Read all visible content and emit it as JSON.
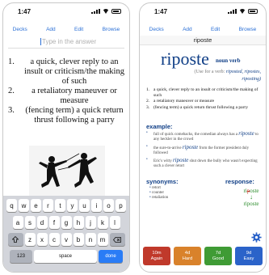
{
  "left": {
    "time": "1:47",
    "nav": [
      "Decks",
      "Add",
      "Edit",
      "Browse"
    ],
    "answer_placeholder": "Type in the answer",
    "definitions": [
      {
        "num": "1.",
        "text": "a quick, clever reply to an insult or criticism/the making of such"
      },
      {
        "num": "2.",
        "text": "a retaliatory maneuver or measure"
      },
      {
        "num": "3.",
        "text": "(fencing term) a quick return thrust following a parry"
      }
    ],
    "keyboard": {
      "row1": [
        "q",
        "w",
        "e",
        "r",
        "t",
        "y",
        "u",
        "i",
        "o",
        "p"
      ],
      "row2": [
        "a",
        "s",
        "d",
        "f",
        "g",
        "h",
        "j",
        "k",
        "l"
      ],
      "row3": [
        "z",
        "x",
        "c",
        "v",
        "b",
        "n",
        "m"
      ],
      "num_label": "123",
      "space_label": "space",
      "done_label": "done",
      "shift_icon": "shift-icon",
      "delete_icon": "delete-icon"
    }
  },
  "right": {
    "time": "1:47",
    "nav": [
      "Decks",
      "Add",
      "Edit",
      "Browse"
    ],
    "title": "riposte",
    "headword": "riposte",
    "part_of_speech": "noun verb",
    "forms_prefix": "(Use for a verb:",
    "forms_list": "riposted, ripostes,",
    "forms_last": "riposting)",
    "definitions": [
      {
        "num": "1.",
        "text": "a quick, clever reply to an insult or criticism/the making of such"
      },
      {
        "num": "2.",
        "text": "a retaliatory maneuver or measure"
      },
      {
        "num": "3.",
        "text": "(fencing term) a quick return thrust following a parry"
      }
    ],
    "example_label": "example:",
    "examples": [
      {
        "pre": "full of quick comebacks, the comedian always has a",
        "word": "riposte",
        "post": "to any heckler in the crowd"
      },
      {
        "pre": "the sure-to-arrive",
        "word": "riposte",
        "post": "from the former president duly followed"
      },
      {
        "pre": "Eric's witty",
        "word": "riposte",
        "post": "shut down the bully who wasn't expecting such a clever retort"
      }
    ],
    "synonyms_label": "synonyms:",
    "synonyms": [
      "retort",
      "counter",
      "retaliation"
    ],
    "response_label": "response:",
    "response_typed_start": "ri",
    "response_typed_wrong": "p",
    "response_typed_end": "oste",
    "response_arrow": "↓",
    "response_correct": "riposte",
    "gear_icon": "gear-icon",
    "grades": [
      {
        "interval": "10m",
        "label": "Again",
        "color": "#c0392b"
      },
      {
        "interval": "4d",
        "label": "Hard",
        "color": "#d9822b"
      },
      {
        "interval": "7d",
        "label": "Good",
        "color": "#3f9b35"
      },
      {
        "interval": "9d",
        "label": "Easy",
        "color": "#2b63c9"
      }
    ]
  }
}
